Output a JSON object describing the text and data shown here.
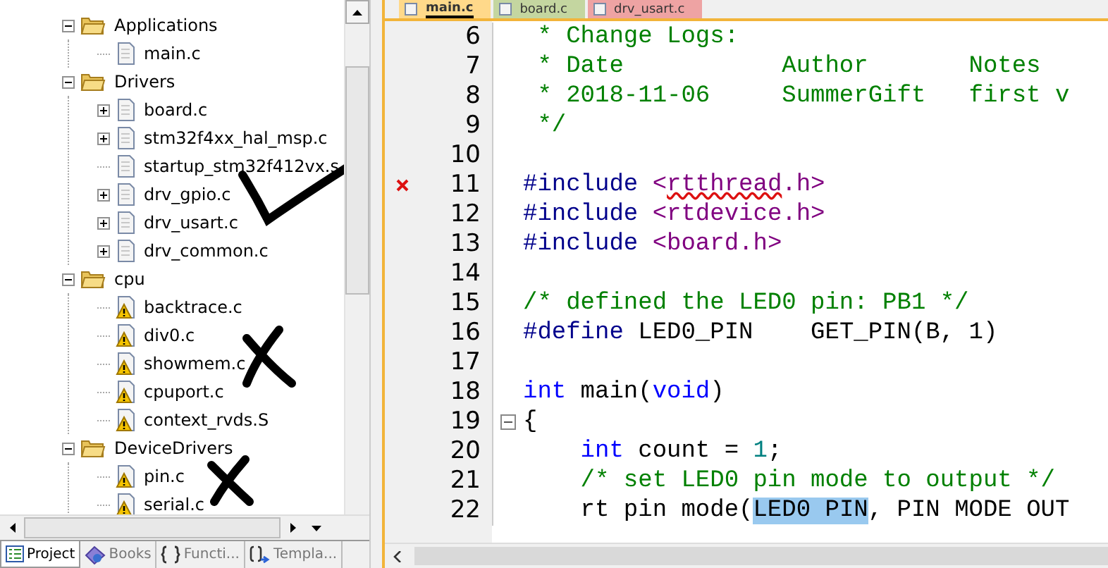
{
  "project_tree": [
    {
      "label": "Applications",
      "kind": "folder",
      "expanded": true,
      "children": [
        {
          "label": "main.c",
          "kind": "file",
          "warning": false
        }
      ]
    },
    {
      "label": "Drivers",
      "kind": "folder",
      "expanded": true,
      "children": [
        {
          "label": "board.c",
          "kind": "file",
          "warning": false,
          "expanded": false
        },
        {
          "label": "stm32f4xx_hal_msp.c",
          "kind": "file",
          "warning": false,
          "expanded": false
        },
        {
          "label": "startup_stm32f412vx.s",
          "kind": "file",
          "warning": false
        },
        {
          "label": "drv_gpio.c",
          "kind": "file",
          "warning": false,
          "expanded": false
        },
        {
          "label": "drv_usart.c",
          "kind": "file",
          "warning": false,
          "expanded": false
        },
        {
          "label": "drv_common.c",
          "kind": "file",
          "warning": false,
          "expanded": false
        }
      ]
    },
    {
      "label": "cpu",
      "kind": "folder",
      "expanded": true,
      "children": [
        {
          "label": "backtrace.c",
          "kind": "file",
          "warning": true
        },
        {
          "label": "div0.c",
          "kind": "file",
          "warning": true
        },
        {
          "label": "showmem.c",
          "kind": "file",
          "warning": true
        },
        {
          "label": "cpuport.c",
          "kind": "file",
          "warning": true
        },
        {
          "label": "context_rvds.S",
          "kind": "file",
          "warning": true
        }
      ]
    },
    {
      "label": "DeviceDrivers",
      "kind": "folder",
      "expanded": true,
      "children": [
        {
          "label": "pin.c",
          "kind": "file",
          "warning": true
        },
        {
          "label": "serial.c",
          "kind": "file",
          "warning": true
        }
      ]
    }
  ],
  "panel_tabs": [
    {
      "label": "Project",
      "selected": true
    },
    {
      "label": "Books",
      "selected": false
    },
    {
      "label": "Functi...",
      "selected": false
    },
    {
      "label": "Templa...",
      "selected": false
    }
  ],
  "editor_tabs": [
    {
      "label": "main.c",
      "color": "#ffd98a",
      "selected": true
    },
    {
      "label": "board.c",
      "color": "#c4d6a0",
      "selected": false
    },
    {
      "label": "drv_usart.c",
      "color": "#eea3a3",
      "selected": false
    }
  ],
  "code_lines": [
    {
      "number": "6",
      "segments": [
        {
          "kind": "comment",
          "text": " * Change Logs:"
        }
      ]
    },
    {
      "number": "7",
      "segments": [
        {
          "kind": "comment",
          "text": " * Date           Author       Notes"
        }
      ]
    },
    {
      "number": "8",
      "segments": [
        {
          "kind": "comment",
          "text": " * 2018-11-06     SummerGift   first v"
        }
      ]
    },
    {
      "number": "9",
      "segments": [
        {
          "kind": "comment",
          "text": " */"
        }
      ]
    },
    {
      "number": "10"
    },
    {
      "number": "11",
      "error": true,
      "segments": [
        {
          "kind": "preproc",
          "text": "#include "
        },
        {
          "kind": "header",
          "text": "<"
        },
        {
          "kind": "header-error",
          "text": "rtthread"
        },
        {
          "kind": "header",
          "text": ".h>"
        }
      ]
    },
    {
      "number": "12",
      "segments": [
        {
          "kind": "preproc",
          "text": "#include "
        },
        {
          "kind": "header",
          "text": "<rtdevice.h>"
        }
      ]
    },
    {
      "number": "13",
      "segments": [
        {
          "kind": "preproc",
          "text": "#include "
        },
        {
          "kind": "header",
          "text": "<board.h>"
        }
      ]
    },
    {
      "number": "14"
    },
    {
      "number": "15",
      "segments": [
        {
          "kind": "comment",
          "text": "/* defined the LED0 pin: PB1 */"
        }
      ]
    },
    {
      "number": "16",
      "segments": [
        {
          "kind": "preproc",
          "text": "#define "
        },
        {
          "kind": "plain",
          "text": "LED0_PIN    GET_PIN(B, 1)"
        }
      ]
    },
    {
      "number": "17"
    },
    {
      "number": "18",
      "segments": [
        {
          "kind": "keyword",
          "text": "int"
        },
        {
          "kind": "plain",
          "text": " main("
        },
        {
          "kind": "keyword",
          "text": "void"
        },
        {
          "kind": "plain",
          "text": ")"
        }
      ]
    },
    {
      "number": "19",
      "fold": true,
      "segments": [
        {
          "kind": "plain",
          "text": "{"
        }
      ]
    },
    {
      "number": "20",
      "segments": [
        {
          "kind": "keyword",
          "text": "    int"
        },
        {
          "kind": "plain",
          "text": " count = "
        },
        {
          "kind": "number",
          "text": "1"
        },
        {
          "kind": "plain",
          "text": ";"
        }
      ]
    },
    {
      "number": "21",
      "segments": [
        {
          "kind": "comment",
          "text": "    /* set LED0 pin mode to output */"
        }
      ]
    },
    {
      "number": "22",
      "segments": [
        {
          "kind": "plain",
          "text": "    rt pin mode("
        },
        {
          "kind": "selected",
          "text": "LED0 PIN"
        },
        {
          "kind": "plain",
          "text": ", PIN MODE OUT"
        }
      ]
    }
  ]
}
